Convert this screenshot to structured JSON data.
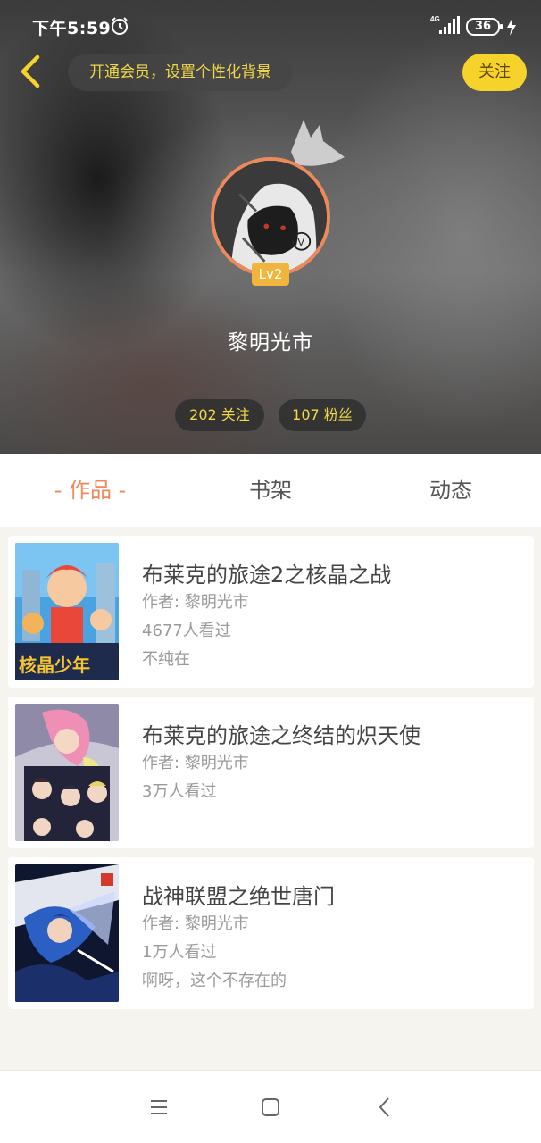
{
  "status_bar": {
    "time": "下午5:59",
    "network": "4G",
    "battery": "36"
  },
  "header": {
    "vip_banner": "开通会员，设置个性化背景",
    "follow_label": "关注"
  },
  "profile": {
    "level": "Lv2",
    "username": "黎明光市",
    "following": "202 关注",
    "fans": "107 粉丝"
  },
  "tabs": [
    {
      "label": "- 作品 -",
      "active": true
    },
    {
      "label": "书架",
      "active": false
    },
    {
      "label": "动态",
      "active": false
    }
  ],
  "works": [
    {
      "title": "布莱克的旅途2之核晶之战",
      "author": "作者: 黎明光市",
      "views": "4677人看过",
      "note": "不纯在",
      "cover_text": "核晶少年"
    },
    {
      "title": "布莱克的旅途之终结的炽天使",
      "author": "作者: 黎明光市",
      "views": "3万人看过",
      "note": ""
    },
    {
      "title": "战神联盟之绝世唐门",
      "author": "作者: 黎明光市",
      "views": "1万人看过",
      "note": "啊呀，这个不存在的"
    }
  ],
  "colors": {
    "accent_orange": "#ec8a5e",
    "follow_yellow": "#f6d32b",
    "pill_text_yellow": "#f3d84a",
    "level_badge": "#f0b53a"
  },
  "icons": {
    "back": "chevron-left-icon",
    "alarm": "alarm-clock-icon",
    "signal": "signal-icon",
    "battery": "battery-icon",
    "crown": "crown-icon",
    "nav_menu": "menu-icon",
    "nav_home": "home-square-icon",
    "nav_back": "back-arrow-icon"
  }
}
